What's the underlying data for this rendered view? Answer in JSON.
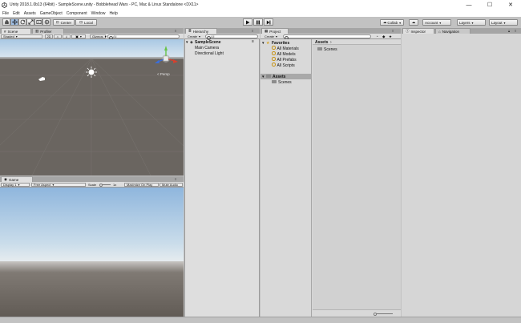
{
  "window": {
    "title": "Unity 2018.1.0b13 (64bit) - SampleScene.unity - Bobblehead Wars - PC, Mac & Linux Standalone <DX11>",
    "minimize": "—",
    "maximize": "☐",
    "close": "✕"
  },
  "menu": [
    "File",
    "Edit",
    "Assets",
    "GameObject",
    "Component",
    "Window",
    "Help"
  ],
  "toolbar": {
    "center": "Center",
    "local": "Local",
    "collab": "Collab",
    "account": "Account",
    "layers": "Layers",
    "layout": "Layout"
  },
  "scene": {
    "tabs": [
      "Scene",
      "Profiler"
    ],
    "shading": "Shaded",
    "mode2d": "2D",
    "gizmos": "Gizmos",
    "search_placeholder": "All",
    "persp": "< Persp",
    "colors": {
      "sky": "#c3dbee",
      "ground": "#6a6560"
    }
  },
  "game": {
    "tab": "Game",
    "display": "Display 1",
    "aspect": "Free Aspect",
    "scale_label": "Scale",
    "scale_value": "1x",
    "maximize_on_play": "Maximize On Play",
    "mute_audio": "Mute Audio"
  },
  "hierarchy": {
    "tab": "Hierarchy",
    "create": "Create",
    "search_placeholder": "All",
    "scene_name": "SampleScene",
    "items": [
      "Main Camera",
      "Directional Light"
    ]
  },
  "project": {
    "tab": "Project",
    "create": "Create",
    "favorites_label": "Favorites",
    "favorites": [
      "All Materials",
      "All Models",
      "All Prefabs",
      "All Scripts"
    ],
    "assets_label": "Assets",
    "tree_children": [
      "Scenes"
    ],
    "breadcrumb": "Assets",
    "files": [
      "Scenes"
    ]
  },
  "inspector": {
    "tabs": [
      "Inspector",
      "Navigation"
    ]
  }
}
